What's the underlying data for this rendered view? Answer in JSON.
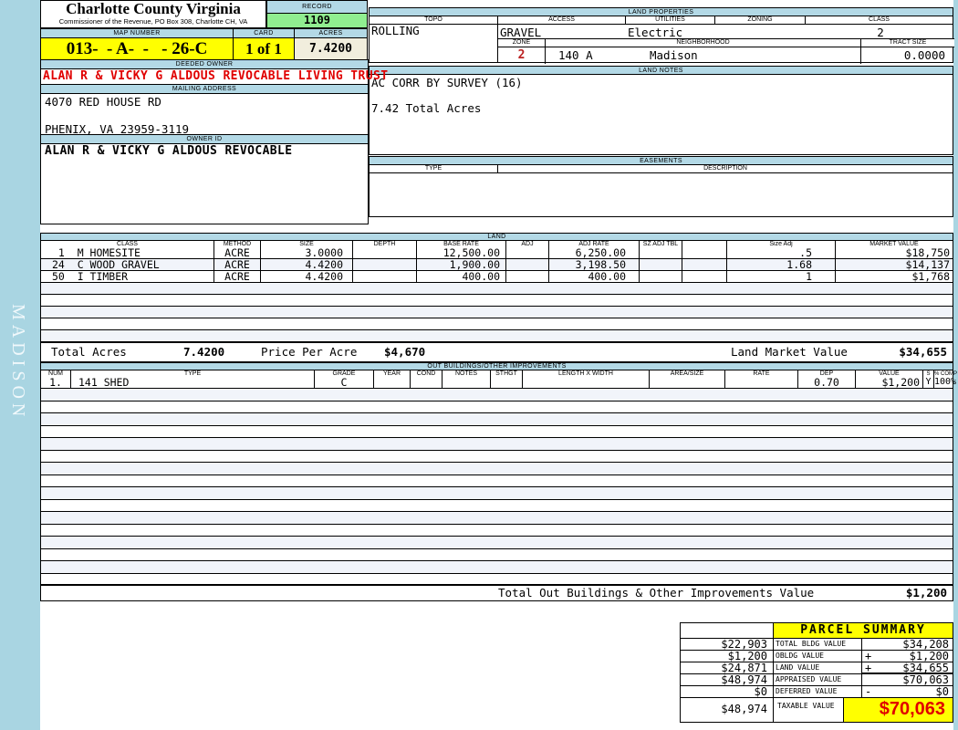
{
  "page": {
    "sidebar_text": "MADISON"
  },
  "colors": {
    "page_background": "#a9d5e2",
    "section_header_blue": "#b3d9e6",
    "record_green": "#90ee90",
    "highlight_yellow": "#ffff00",
    "acres_cream": "#f1eedd",
    "owner_red": "#e00000",
    "stripe": "#f1f4fa"
  },
  "header": {
    "county": "Charlotte County Virginia",
    "commissioner": "Commissioner of the Revenue, PO Box 308, Charlotte CH, VA",
    "record_label": "RECORD",
    "record_value": "1109",
    "map_number_label": "MAP NUMBER",
    "map_number": "013-  - A-  -   - 26-C",
    "card_label": "CARD",
    "card_value": "1 of 1",
    "acres_label": "ACRES",
    "acres_value": "7.4200"
  },
  "owner": {
    "deeded_owner_label": "DEEDED OWNER",
    "deeded_owner": "ALAN R & VICKY G ALDOUS REVOCABLE LIVING TRUST",
    "mailing_address_label": "MAILING ADDRESS",
    "address_line1": "4070 RED HOUSE RD",
    "address_line2": "PHENIX, VA 23959-3119",
    "owner_id_label": "OWNER ID",
    "owner_id": "ALAN R & VICKY G ALDOUS REVOCABLE"
  },
  "land_properties": {
    "title": "LAND PROPERTIES",
    "topo_label": "TOPO",
    "topo": "ROLLING",
    "access_label": "ACCESS",
    "access": "GRAVEL",
    "utilities_label": "UTILITIES",
    "utilities": "Electric",
    "zoning_label": "ZONING",
    "zoning": "",
    "class_label": "CLASS",
    "class": "2",
    "zone_label": "ZONE",
    "zone": "2",
    "neighborhood_label": "NEIGHBORHOOD",
    "neighborhood_code": "140 A",
    "neighborhood": "Madison",
    "tract_size_label": "TRACT SIZE",
    "tract_size": "0.0000"
  },
  "land_notes": {
    "title": "LAND NOTES",
    "line1": "AC CORR BY SURVEY (16)",
    "line2": "7.42 Total Acres"
  },
  "easements": {
    "title": "EASEMENTS",
    "type_label": "TYPE",
    "description_label": "DESCRIPTION"
  },
  "land": {
    "title": "LAND",
    "headers": [
      "CLASS",
      "METHOD",
      "SIZE",
      "DEPTH",
      "BASE RATE",
      "ADJ",
      "ADJ RATE",
      "SZ ADJ TBL",
      "",
      "Size Adj",
      "MARKET VALUE"
    ],
    "rows": [
      {
        "class": " 1  M HOMESITE",
        "method": "ACRE",
        "size": "3.0000",
        "depth": "",
        "base_rate": "12,500.00",
        "adj": "",
        "adj_rate": "6,250.00",
        "sz_adj_tbl": "",
        "size_adj": ".5",
        "market_value": "$18,750"
      },
      {
        "class": "24  C WOOD GRAVEL",
        "method": "ACRE",
        "size": "4.4200",
        "depth": "",
        "base_rate": "1,900.00",
        "adj": "",
        "adj_rate": "3,198.50",
        "sz_adj_tbl": "",
        "size_adj": "1.68",
        "market_value": "$14,137"
      },
      {
        "class": "50  I TIMBER",
        "method": "ACRE",
        "size": "4.4200",
        "depth": "",
        "base_rate": "400.00",
        "adj": "",
        "adj_rate": "400.00",
        "sz_adj_tbl": "",
        "size_adj": "1",
        "market_value": "$1,768"
      }
    ],
    "total_acres_label": "Total Acres",
    "total_acres": "7.4200",
    "price_per_acre_label": "Price Per Acre",
    "price_per_acre": "$4,670",
    "land_market_value_label": "Land Market Value",
    "land_market_value": "$34,655"
  },
  "out_buildings": {
    "title": "OUT BUILDINGS/OTHER IMPROVEMENTS",
    "headers": [
      "NUM",
      "TYPE",
      "GRADE",
      "YEAR",
      "COND",
      "NOTES",
      "STHGT",
      "LENGTH X WIDTH",
      "AREA/SIZE",
      "RATE",
      "DEP",
      "VALUE",
      "S",
      "% COMP"
    ],
    "rows": [
      {
        "num": "1.",
        "type": "141 SHED",
        "grade": "C",
        "year": "",
        "cond": "",
        "notes": "",
        "sthgt": "",
        "length_width": "",
        "area_size": "",
        "rate": "",
        "dep": "0.70",
        "value": "$1,200",
        "s": "Y",
        "pct_comp": "100%"
      }
    ],
    "total_label": "Total Out Buildings & Other Improvements Value",
    "total_value": "$1,200"
  },
  "parcel_summary": {
    "title": "PARCEL SUMMARY",
    "rows": [
      {
        "left": "$22,903",
        "label": "TOTAL BLDG VALUE",
        "sign": "",
        "right": "$34,208"
      },
      {
        "left": "$1,200",
        "label": "OBLDG VALUE",
        "sign": "+",
        "right": "$1,200"
      },
      {
        "left": "$24,871",
        "label": "LAND VALUE",
        "sign": "+",
        "right": "$34,655"
      },
      {
        "left": "$48,974",
        "label": "APPRAISED VALUE",
        "sign": "",
        "right": "$70,063"
      },
      {
        "left": "$0",
        "label": "DEFERRED VALUE",
        "sign": "-",
        "right": "$0"
      },
      {
        "left": "$48,974",
        "label": "TAXABLE VALUE",
        "sign": "",
        "right": "$70,063"
      }
    ]
  }
}
